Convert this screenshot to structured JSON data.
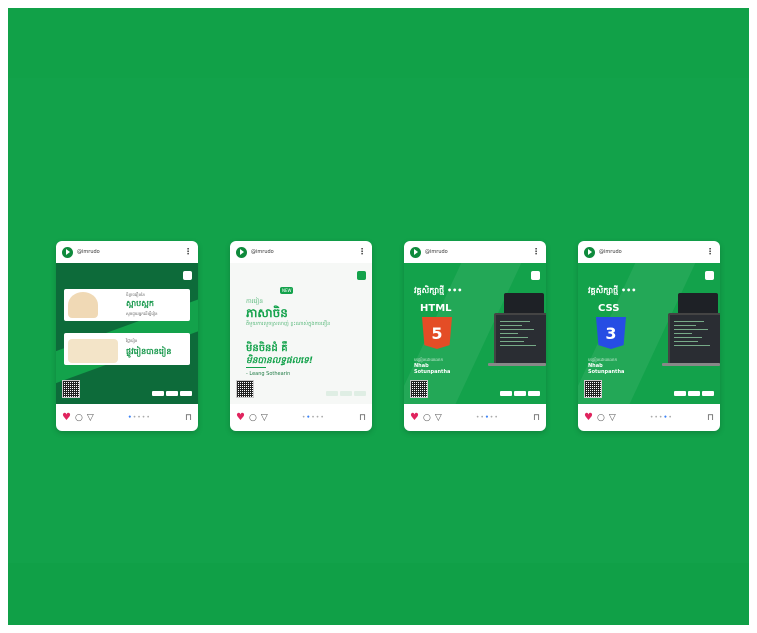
{
  "cards": [
    {
      "username": "@imrudo",
      "panel1_line1": "ចិន្តាចរឿននៃ",
      "panel1_title": "ស្អាបស្អក",
      "panel1_sub": "សូមជួយអ្នកដើម្បីរៀន",
      "panel2_line1": "វិជ្ជារៀន",
      "panel2_title": "ផ្លូវរៀនបានរៀន"
    },
    {
      "username": "@imrudo",
      "badge": "NEW",
      "line1": "ការរៀន",
      "line2": "ភាសាចិន",
      "line3": "គឺមួយការលួចស្រលាញ់ ខ្លះណាស់ក្នុងការពឿន",
      "line4": "មិនចិនដំ គឺ",
      "line5": "មិនបានលទ្ធផលទេ!",
      "author": "- Leang Sothearin"
    },
    {
      "username": "@imrudo",
      "title": "វគ្គសិក្សាថ្មី •••",
      "lang": "HTML",
      "badge_char": "5",
      "by": "បង្រៀនដោយលោក",
      "name": "Nhab Sotunpantha"
    },
    {
      "username": "@imrudo",
      "title": "វគ្គសិក្សាថ្មី •••",
      "lang": "CSS",
      "badge_char": "3",
      "by": "បង្រៀនដោយលោក",
      "name": "Nhab Sotunpantha"
    }
  ],
  "colors": {
    "background": "#12a24a",
    "brand": "#13a24b",
    "heart": "#e0245e",
    "html5": "#e44d26",
    "css3": "#264de4"
  },
  "icons": {
    "like": "heart-icon",
    "comment": "comment-icon",
    "share": "share-icon",
    "save": "bookmark-icon",
    "more": "more-icon"
  }
}
